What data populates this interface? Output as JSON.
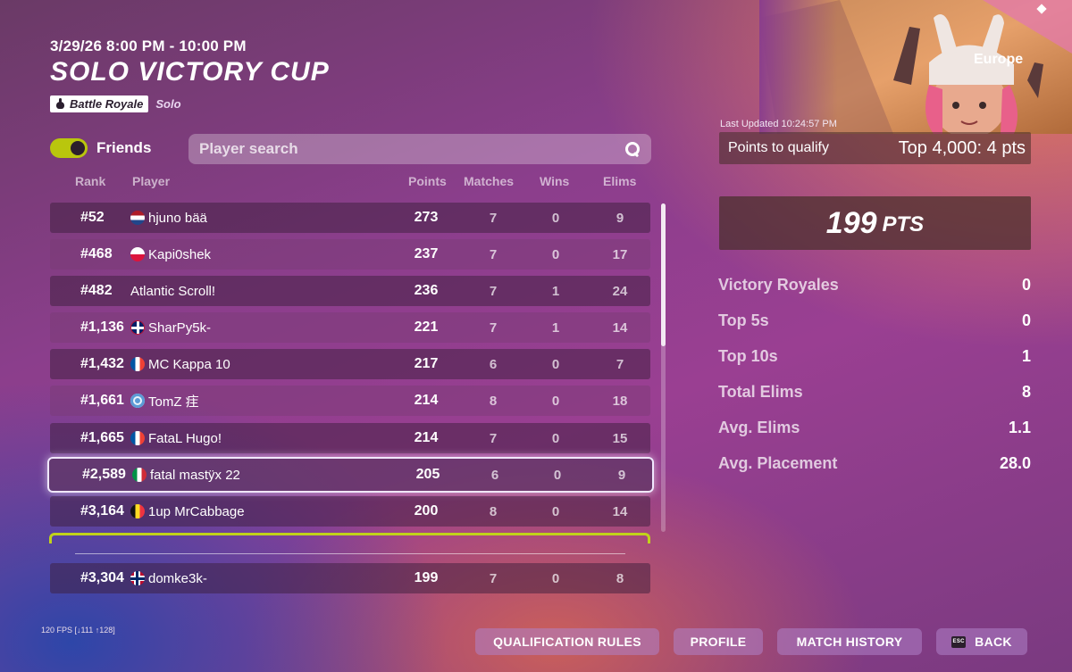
{
  "event": {
    "time": "3/29/26 8:00 PM - 10:00 PM",
    "title": "SOLO VICTORY CUP",
    "mode_badge": "Battle Royale",
    "mode_sub": "Solo"
  },
  "friends_toggle": {
    "label": "Friends",
    "on": true
  },
  "search": {
    "placeholder": "Player search",
    "value": ""
  },
  "columns": {
    "rank": "Rank",
    "player": "Player",
    "points": "Points",
    "matches": "Matches",
    "wins": "Wins",
    "elims": "Elims"
  },
  "rows": [
    {
      "rank": "#52",
      "flag": "nl",
      "player": "hjuno bää",
      "points": "273",
      "matches": "7",
      "wins": "0",
      "elims": "9"
    },
    {
      "rank": "#468",
      "flag": "pl",
      "player": "Kapi0shek",
      "points": "237",
      "matches": "7",
      "wins": "0",
      "elims": "17"
    },
    {
      "rank": "#482",
      "flag": "",
      "player": "Atlantic Scroll!",
      "points": "236",
      "matches": "7",
      "wins": "1",
      "elims": "24"
    },
    {
      "rank": "#1,136",
      "flag": "gb",
      "player": "SharPy5k-",
      "points": "221",
      "matches": "7",
      "wins": "1",
      "elims": "14"
    },
    {
      "rank": "#1,432",
      "flag": "fr",
      "player": "MC Kappa 10",
      "points": "217",
      "matches": "6",
      "wins": "0",
      "elims": "7"
    },
    {
      "rank": "#1,661",
      "flag": "un",
      "player": "TomZ 疰",
      "points": "214",
      "matches": "8",
      "wins": "0",
      "elims": "18"
    },
    {
      "rank": "#1,665",
      "flag": "fr",
      "player": "FataL Hugo!",
      "points": "214",
      "matches": "7",
      "wins": "0",
      "elims": "15"
    },
    {
      "rank": "#2,589",
      "flag": "it",
      "player": "fatal mastÿx 22",
      "points": "205",
      "matches": "6",
      "wins": "0",
      "elims": "9",
      "selected": true
    },
    {
      "rank": "#3,164",
      "flag": "be",
      "player": "1up MrCabbage",
      "points": "200",
      "matches": "8",
      "wins": "0",
      "elims": "14"
    }
  ],
  "own_row": {
    "rank": "#3,304",
    "flag": "no",
    "player": "domke3k-",
    "points": "199",
    "matches": "7",
    "wins": "0",
    "elims": "8"
  },
  "panel": {
    "region": "Europe",
    "last_updated": "Last Updated 10:24:57 PM",
    "qualify_label": "Points to qualify",
    "qualify_value": "Top 4,000: 4 pts",
    "points_value": "199",
    "points_unit": "PTS",
    "stats": [
      {
        "label": "Victory Royales",
        "value": "0"
      },
      {
        "label": "Top 5s",
        "value": "0"
      },
      {
        "label": "Top 10s",
        "value": "1"
      },
      {
        "label": "Total Elims",
        "value": "8"
      },
      {
        "label": "Avg. Elims",
        "value": "1.1"
      },
      {
        "label": "Avg. Placement",
        "value": "28.0"
      }
    ]
  },
  "fps_text": "120 FPS [↓111 ↑128]",
  "buttons": {
    "qualification_rules": "QUALIFICATION RULES",
    "profile": "PROFILE",
    "match_history": "MATCH HISTORY",
    "esc_key": "ESC",
    "back": "BACK"
  },
  "colors": {
    "toggle_on": "#b9c60d",
    "own_row_outline": "#c1d21a",
    "selected_outline": "#f1e8ff"
  }
}
